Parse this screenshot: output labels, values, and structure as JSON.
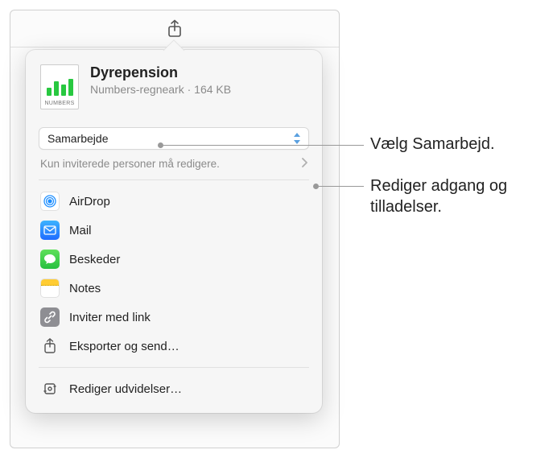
{
  "file": {
    "title": "Dyrepension",
    "type": "Numbers-regneark",
    "size": "164 KB",
    "icon_caption": "NUMBERS"
  },
  "mode": {
    "selected": "Samarbejde"
  },
  "permissions": {
    "summary": "Kun inviterede personer må redigere."
  },
  "share_targets": [
    {
      "id": "airdrop",
      "label": "AirDrop"
    },
    {
      "id": "mail",
      "label": "Mail"
    },
    {
      "id": "beskeder",
      "label": "Beskeder"
    },
    {
      "id": "notes",
      "label": "Notes"
    },
    {
      "id": "invite-link",
      "label": "Inviter med link"
    },
    {
      "id": "export-send",
      "label": "Eksporter og send…"
    }
  ],
  "footer": {
    "edit_extensions": "Rediger udvidelser…"
  },
  "callouts": {
    "choose_collab": "Vælg Samarbejd.",
    "edit_access": "Rediger adgang og tilladelser."
  }
}
